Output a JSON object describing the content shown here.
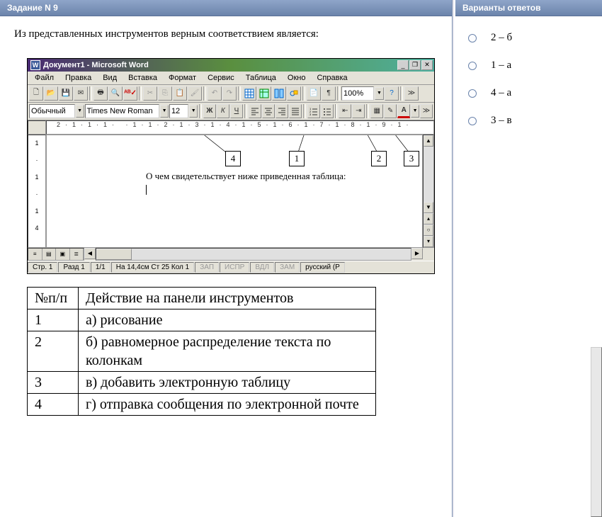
{
  "left": {
    "header": "Задание N 9",
    "question_text": "Из представленных инструментов  верным соответствием является:"
  },
  "word": {
    "title": "Документ1 - Microsoft Word",
    "menu": [
      "Файл",
      "Правка",
      "Вид",
      "Вставка",
      "Формат",
      "Сервис",
      "Таблица",
      "Окно",
      "Справка"
    ],
    "style": "Обычный",
    "font": "Times New Roman",
    "size": "12",
    "zoom": "100%",
    "doc_text": "О чем свидетельствует ниже приведенная таблица:",
    "h_ruler": "2·1·1·1· ·1·1·2·1·3·1·4·1·5·1·6·1·7·1·8·1·9·1·",
    "v_ruler": [
      "1",
      "·",
      "1",
      "·",
      "·",
      "1",
      "4"
    ],
    "status": {
      "page": "Стр. 1",
      "section": "Разд 1",
      "pagecount": "1/1",
      "position": "На 14,4см  Ст 25  Кол 1",
      "modes": [
        "ЗАП",
        "ИСПР",
        "ВДЛ",
        "ЗАМ"
      ],
      "lang": "русский (Р"
    },
    "callouts": [
      "4",
      "1",
      "2",
      "3"
    ]
  },
  "table": {
    "header": [
      "№п/п",
      "Действие на панели инструментов"
    ],
    "rows": [
      [
        "1",
        "а) рисование"
      ],
      [
        "2",
        "б) равномерное распределение текста по колонкам"
      ],
      [
        "3",
        "в) добавить электронную таблицу"
      ],
      [
        "4",
        "г) отправка сообщения по электронной почте"
      ]
    ]
  },
  "answers": {
    "header": "Варианты ответов",
    "options": [
      "2 – б",
      "1 – а",
      "4 – а",
      "3 – в"
    ]
  }
}
